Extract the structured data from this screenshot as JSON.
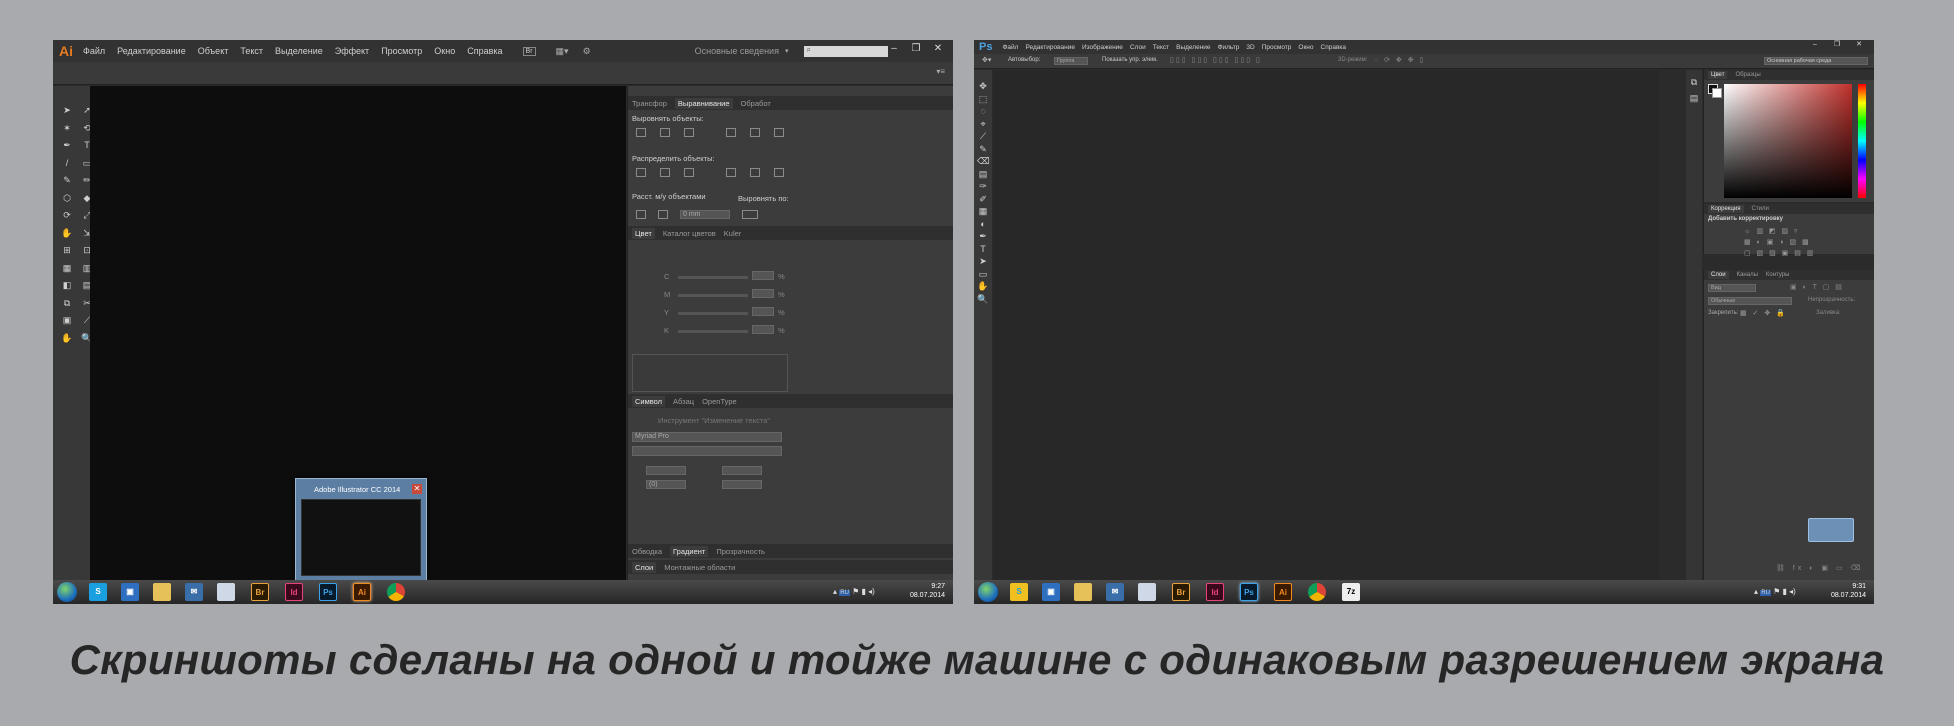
{
  "illustrator": {
    "logo": "Ai",
    "menu": [
      "Файл",
      "Редактирование",
      "Объект",
      "Текст",
      "Выделение",
      "Эффект",
      "Просмотр",
      "Окно",
      "Справка"
    ],
    "bridge_label": "Br",
    "workspace": "Основные сведения",
    "window_buttons": [
      "–",
      "❐",
      "✕"
    ],
    "align_panel": {
      "tabs": [
        "Трансфор",
        "Выравнивание",
        "Обработ"
      ],
      "align_objects": "Выровнять объекты:",
      "distribute_objects": "Распределить объекты:",
      "distribute_spacing": "Расст. м/у объектами",
      "align_to": "Выровнять по:",
      "spacing_value": "0 mm"
    },
    "color_panel": {
      "tabs": [
        "Цвет",
        "Каталог цветов",
        "Kuler"
      ],
      "channels": [
        "C",
        "M",
        "Y",
        "K"
      ],
      "percent": "%"
    },
    "character_panel": {
      "tabs": [
        "Символ",
        "Абзац",
        "OpenType"
      ],
      "touch_type": "Инструмент \"Изменение текста\"",
      "font": "Myriad Pro",
      "leading": "(0)"
    },
    "bottom_tabs_1": [
      "Обводка",
      "Градиент",
      "Прозрачность"
    ],
    "bottom_tabs_2": [
      "Слои",
      "Монтажные области"
    ],
    "thumbnail_title": "Adobe Illustrator CC 2014",
    "clock": {
      "time": "9:27",
      "date": "08.07.2014"
    },
    "tray_lang": "RU"
  },
  "photoshop": {
    "logo": "Ps",
    "menu": [
      "Файл",
      "Редактирование",
      "Изображение",
      "Слои",
      "Текст",
      "Выделение",
      "Фильтр",
      "3D",
      "Просмотр",
      "Окно",
      "Справка"
    ],
    "options": {
      "autoselect": "Автовыбор:",
      "group": "Группа",
      "show_controls": "Показать упр. элем.",
      "mode3d": "3D-режим:"
    },
    "workspace": "Основная рабочая среда",
    "window_buttons": [
      "–",
      "❐",
      "✕"
    ],
    "color_tabs": [
      "Цвет",
      "Образцы"
    ],
    "adjust_tabs": [
      "Коррекция",
      "Стили"
    ],
    "add_adjustment": "Добавить корректировку",
    "layers_tabs": [
      "Слои",
      "Каналы",
      "Контуры"
    ],
    "layer_kind": "Вид",
    "blend_mode": "Обычные",
    "opacity_label": "Непрозрачность:",
    "lock_label": "Закрепить:",
    "fill_label": "Заливка:",
    "clock": {
      "time": "9:31",
      "date": "08.07.2014"
    },
    "tray_lang": "RU"
  },
  "taskbar_icons": [
    "Br",
    "Id",
    "Ps",
    "Ai"
  ],
  "caption": "Скриншоты сделаны на одной и тойже машине с одинаковым разрешением экрана"
}
